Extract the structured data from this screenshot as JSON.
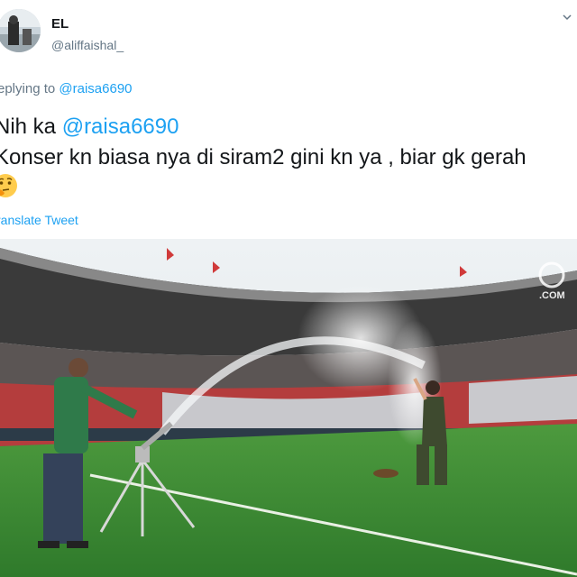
{
  "user": {
    "name": "EL",
    "handle": "@aliffaishal_"
  },
  "reply": {
    "prefix": "eplying to",
    "mention": "@raisa6690"
  },
  "tweet": {
    "line1_prefix": "Nih ka",
    "line1_mention": "@raisa6690",
    "line2": "Konser kn biasa nya di siram2 gini kn ya , biar gk gerah",
    "emoji": "thinking-face"
  },
  "translate_label": "ranslate Tweet",
  "photo": {
    "watermark": ".COM"
  },
  "colors": {
    "link": "#1da1f2",
    "muted": "#657786",
    "grass": "#3f8f36",
    "shirt": "#2f7a4a"
  }
}
